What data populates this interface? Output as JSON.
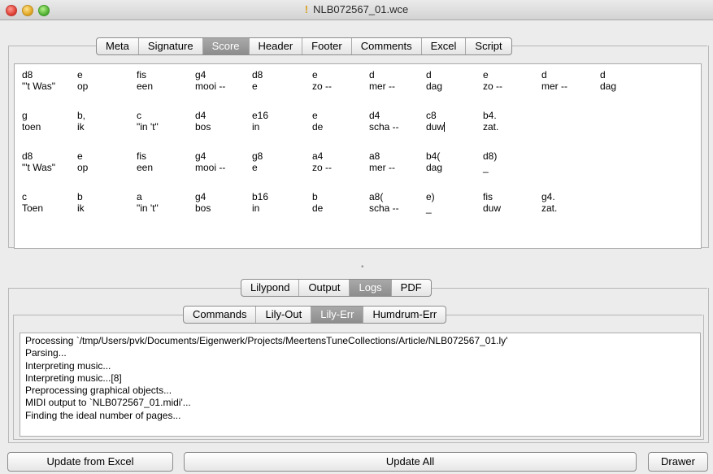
{
  "window": {
    "title": "NLB072567_01.wce",
    "doc_icon": "!"
  },
  "top_tabs": [
    {
      "label": "Meta",
      "active": false
    },
    {
      "label": "Signature",
      "active": false
    },
    {
      "label": "Score",
      "active": true
    },
    {
      "label": "Header",
      "active": false
    },
    {
      "label": "Footer",
      "active": false
    },
    {
      "label": "Comments",
      "active": false
    },
    {
      "label": "Excel",
      "active": false
    },
    {
      "label": "Script",
      "active": false
    }
  ],
  "score": {
    "rows": [
      [
        [
          "d8",
          "\"'t Was\""
        ],
        [
          "e",
          "op"
        ],
        [
          "fis",
          "een"
        ],
        [
          "g4",
          "mooi --"
        ],
        [
          "d8",
          "e"
        ],
        [
          "e",
          "zo --"
        ],
        [
          "d",
          "mer --"
        ],
        [
          "d",
          "dag"
        ],
        [
          "e",
          "zo --"
        ],
        [
          "d",
          "mer --"
        ],
        [
          "d",
          "dag"
        ]
      ],
      [
        [
          "g",
          "toen"
        ],
        [
          "b,",
          "ik"
        ],
        [
          "c",
          "\"in 't\""
        ],
        [
          "d4",
          "bos"
        ],
        [
          "e16",
          "in"
        ],
        [
          "e",
          "de"
        ],
        [
          "d4",
          "scha --"
        ],
        [
          "c8",
          "duw"
        ],
        [
          "b4.",
          "zat."
        ]
      ],
      [
        [
          "d8",
          "\"'t Was\""
        ],
        [
          "e",
          "op"
        ],
        [
          "fis",
          "een"
        ],
        [
          "g4",
          "mooi --"
        ],
        [
          "g8",
          "e"
        ],
        [
          "a4",
          "zo --"
        ],
        [
          "a8",
          "mer --"
        ],
        [
          "b4(",
          "dag"
        ],
        [
          "d8)",
          "_"
        ]
      ],
      [
        [
          "c",
          "Toen"
        ],
        [
          "b",
          "ik"
        ],
        [
          "a",
          "\"in 't\""
        ],
        [
          "g4",
          "bos"
        ],
        [
          "b16",
          "in"
        ],
        [
          "b",
          "de"
        ],
        [
          "a8(",
          "scha --"
        ],
        [
          "e)",
          "_"
        ],
        [
          "fis",
          "duw"
        ],
        [
          "g4.",
          "zat."
        ]
      ]
    ]
  },
  "output_tabs": [
    {
      "label": "Lilypond",
      "active": false
    },
    {
      "label": "Output",
      "active": false
    },
    {
      "label": "Logs",
      "active": true
    },
    {
      "label": "PDF",
      "active": false
    }
  ],
  "log_tabs": [
    {
      "label": "Commands",
      "active": false
    },
    {
      "label": "Lily-Out",
      "active": false
    },
    {
      "label": "Lily-Err",
      "active": true
    },
    {
      "label": "Humdrum-Err",
      "active": false
    }
  ],
  "log_lines": [
    "Processing `/tmp/Users/pvk/Documents/Eigenwerk/Projects/MeertensTuneCollections/Article/NLB072567_01.ly'",
    "Parsing...",
    "Interpreting music...",
    "Interpreting music...[8]",
    "Preprocessing graphical objects...",
    "MIDI output to `NLB072567_01.midi'...",
    "Finding the ideal number of pages..."
  ],
  "buttons": {
    "update_from_excel": "Update from Excel",
    "update_all": "Update All",
    "drawer": "Drawer"
  }
}
